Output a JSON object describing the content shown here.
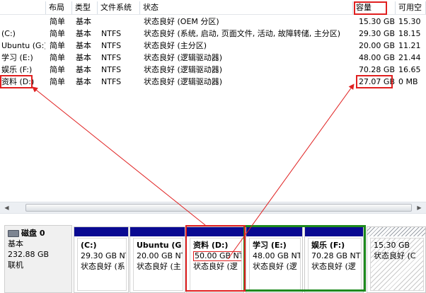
{
  "columns": {
    "volume": "",
    "layout": "布局",
    "type": "类型",
    "fs": "文件系统",
    "status": "状态",
    "capacity": "容量",
    "free": "可用空"
  },
  "volumes": [
    {
      "name": "",
      "layout": "简单",
      "type": "基本",
      "fs": "",
      "status": "状态良好 (OEM 分区)",
      "capacity": "15.30 GB",
      "free": "15.30"
    },
    {
      "name": "(C:)",
      "layout": "简单",
      "type": "基本",
      "fs": "NTFS",
      "status": "状态良好 (系统, 启动, 页面文件, 活动, 故障转储, 主分区)",
      "capacity": "29.30 GB",
      "free": "18.15"
    },
    {
      "name": "Ubuntu (G:)",
      "layout": "简单",
      "type": "基本",
      "fs": "NTFS",
      "status": "状态良好 (主分区)",
      "capacity": "20.00 GB",
      "free": "11.21"
    },
    {
      "name": "学习 (E:)",
      "layout": "简单",
      "type": "基本",
      "fs": "NTFS",
      "status": "状态良好 (逻辑驱动器)",
      "capacity": "48.00 GB",
      "free": "21.44"
    },
    {
      "name": "娱乐 (F:)",
      "layout": "简单",
      "type": "基本",
      "fs": "NTFS",
      "status": "状态良好 (逻辑驱动器)",
      "capacity": "70.28 GB",
      "free": "16.65"
    },
    {
      "name": "资料 (D:)",
      "layout": "简单",
      "type": "基本",
      "fs": "NTFS",
      "status": "状态良好 (逻辑驱动器)",
      "capacity": "27.07 GB",
      "free": "0 MB"
    }
  ],
  "disk": {
    "name": "磁盘 0",
    "type": "基本",
    "size": "232.88 GB",
    "state": "联机"
  },
  "partitions": [
    {
      "name": "(C:)",
      "size": "29.30 GB NT",
      "status": "状态良好 (系"
    },
    {
      "name": "Ubuntu (G",
      "size": "20.00 GB NT",
      "status": "状态良好 (主"
    },
    {
      "name": "资料 (D:)",
      "size": "50.00 GB NT",
      "status": "状态良好 (逻"
    },
    {
      "name": "学习 (E:)",
      "size": "48.00 GB NT",
      "status": "状态良好 (逻"
    },
    {
      "name": "娱乐 (F:)",
      "size": "70.28 GB NT",
      "status": "状态良好 (逻"
    },
    {
      "name": "",
      "size": "15.30 GB",
      "status": "状态良好 (C"
    }
  ],
  "colors": {
    "primary_partition_bar": "#0a0a92",
    "annotation_red": "#e02020",
    "annotation_green": "#1e8a1e"
  }
}
